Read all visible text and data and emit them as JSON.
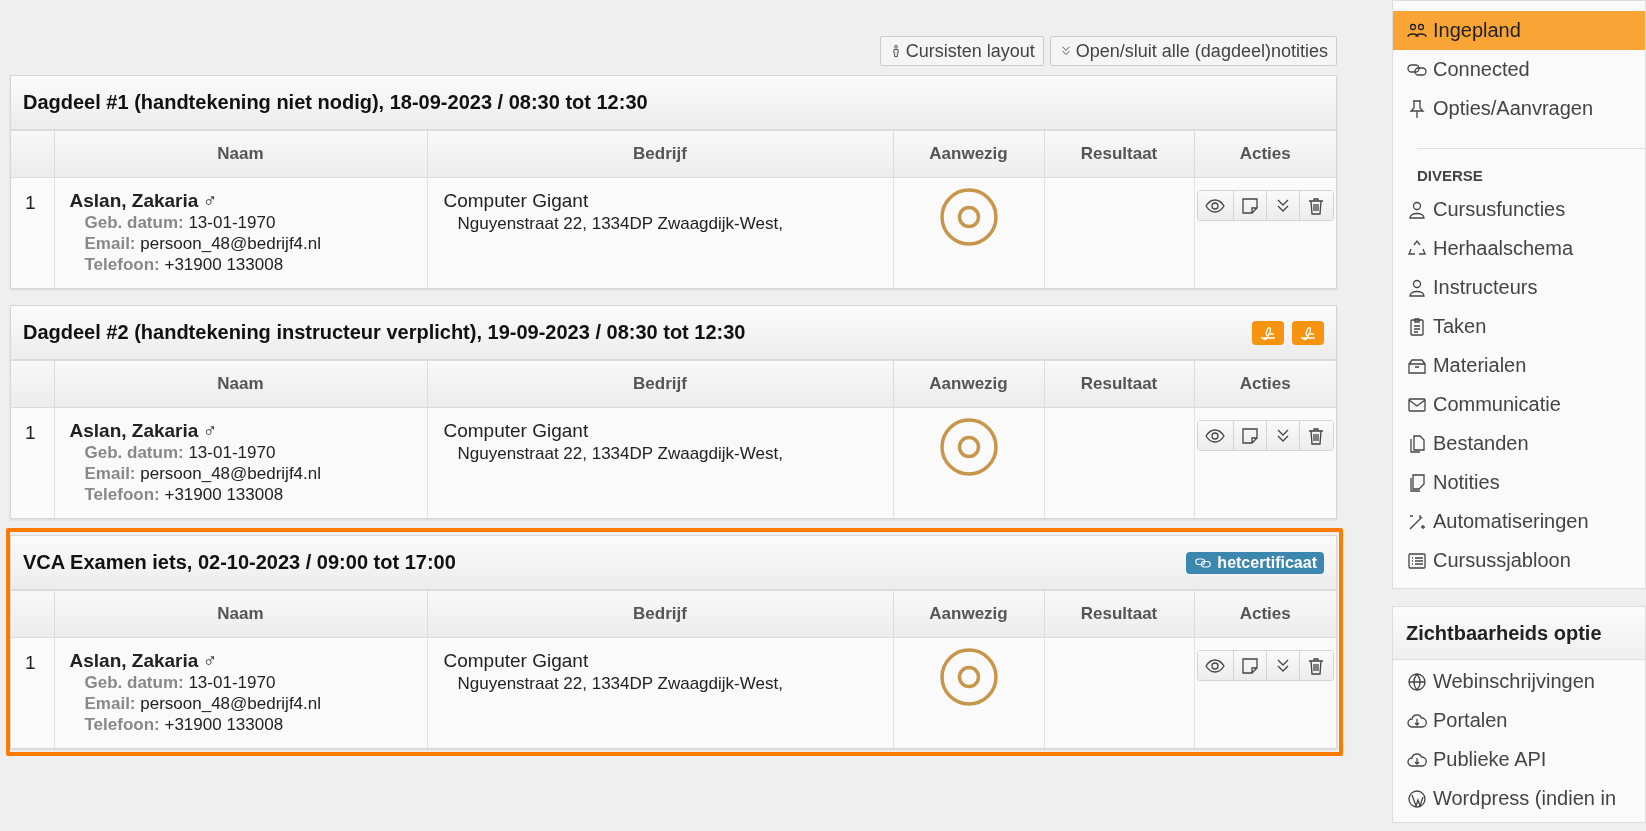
{
  "toolbar": {
    "buttons": [
      {
        "label": "Cursisten layout"
      },
      {
        "label": "Open/sluit alle (dagdeel)notities"
      }
    ]
  },
  "sections": [
    {
      "title": "Dagdeel #1 (handtekening niet nodig), 18-09-2023 / 08:30 tot 12:30",
      "highlighted": false,
      "columns": [
        "Naam",
        "Bedrijf",
        "Aanwezig",
        "Resultaat",
        "Acties"
      ],
      "rows": [
        {
          "index": "1",
          "name": "Aslan, Zakaria",
          "gender": "♂",
          "details": [
            {
              "label": "Geb. datum:",
              "value": "13-01-1970"
            },
            {
              "label": "Email:",
              "value": "persoon_48@bedrijf4.nl"
            },
            {
              "label": "Telefoon:",
              "value": "+31900 133008"
            }
          ],
          "company": "Computer Gigant",
          "address": "Nguyenstraat 22, 1334DP Zwaagdijk-West,"
        }
      ]
    },
    {
      "title": "Dagdeel #2 (handtekening instructeur verplicht), 19-09-2023 / 08:30 tot 12:30",
      "highlighted": false,
      "badges": [
        {
          "kind": "signature"
        },
        {
          "kind": "signature"
        }
      ],
      "columns": [
        "Naam",
        "Bedrijf",
        "Aanwezig",
        "Resultaat",
        "Acties"
      ],
      "rows": [
        {
          "index": "1",
          "name": "Aslan, Zakaria",
          "gender": "♂",
          "details": [
            {
              "label": "Geb. datum:",
              "value": "13-01-1970"
            },
            {
              "label": "Email:",
              "value": "persoon_48@bedrijf4.nl"
            },
            {
              "label": "Telefoon:",
              "value": "+31900 133008"
            }
          ],
          "company": "Computer Gigant",
          "address": "Nguyenstraat 22, 1334DP Zwaagdijk-West,"
        }
      ]
    },
    {
      "title": "VCA Examen iets, 02-10-2023 / 09:00 tot 17:00",
      "highlighted": true,
      "badges": [
        {
          "kind": "link",
          "label": "hetcertificaat"
        }
      ],
      "columns": [
        "Naam",
        "Bedrijf",
        "Aanwezig",
        "Resultaat",
        "Acties"
      ],
      "rows": [
        {
          "index": "1",
          "name": "Aslan, Zakaria",
          "gender": "♂",
          "details": [
            {
              "label": "Geb. datum:",
              "value": "13-01-1970"
            },
            {
              "label": "Email:",
              "value": "persoon_48@bedrijf4.nl"
            },
            {
              "label": "Telefoon:",
              "value": "+31900 133008"
            }
          ],
          "company": "Computer Gigant",
          "address": "Nguyenstraat 22, 1334DP Zwaagdijk-West,"
        }
      ]
    }
  ],
  "sidebar": {
    "items": [
      {
        "label": "Ingepland",
        "selected": true
      },
      {
        "label": "Connected",
        "selected": false
      },
      {
        "label": "Opties/Aanvragen",
        "selected": false
      }
    ],
    "group_heading": "DIVERSE",
    "group_items": [
      {
        "label": "Cursusfuncties",
        "selected": false
      },
      {
        "label": "Herhaalschema",
        "selected": false
      },
      {
        "label": "Instructeurs",
        "selected": false
      },
      {
        "label": "Taken",
        "selected": false
      },
      {
        "label": "Materialen",
        "selected": false
      },
      {
        "label": "Communicatie",
        "selected": false
      },
      {
        "label": "Bestanden",
        "selected": false
      },
      {
        "label": "Notities",
        "selected": false
      },
      {
        "label": "Automatiseringen",
        "selected": false
      },
      {
        "label": "Cursussjabloon",
        "selected": false
      }
    ]
  },
  "visibility_panel": {
    "title": "Zichtbaarheids optie",
    "items": [
      {
        "label": "Webinschrijvingen"
      },
      {
        "label": "Portalen"
      },
      {
        "label": "Publieke API"
      },
      {
        "label": "Wordpress (indien in"
      }
    ]
  }
}
